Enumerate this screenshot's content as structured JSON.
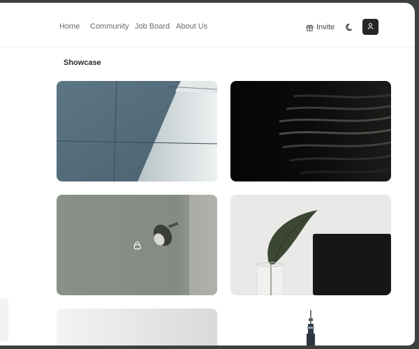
{
  "nav": {
    "items": [
      {
        "label": "Home"
      },
      {
        "label": "Community"
      },
      {
        "label": "Job Board"
      },
      {
        "label": "About Us"
      }
    ],
    "invite_label": "Invite",
    "icons": {
      "invite": "gift-icon",
      "theme": "moon-icon",
      "profile": "user-icon"
    }
  },
  "showcase": {
    "title": "Showcase",
    "cards": [
      {
        "subject": "architecture-facade"
      },
      {
        "subject": "dark-waves"
      },
      {
        "subject": "wall-lamp",
        "locked": true,
        "lock_icon": "lock-icon"
      },
      {
        "subject": "plant-in-glass"
      },
      {
        "subject": "gradient-gray"
      },
      {
        "subject": "tower"
      }
    ]
  },
  "colors": {
    "frame": "#3d413d",
    "profile_button": "#262626",
    "text_muted": "#6b6b6b",
    "text_strong": "#2a2a2a"
  }
}
